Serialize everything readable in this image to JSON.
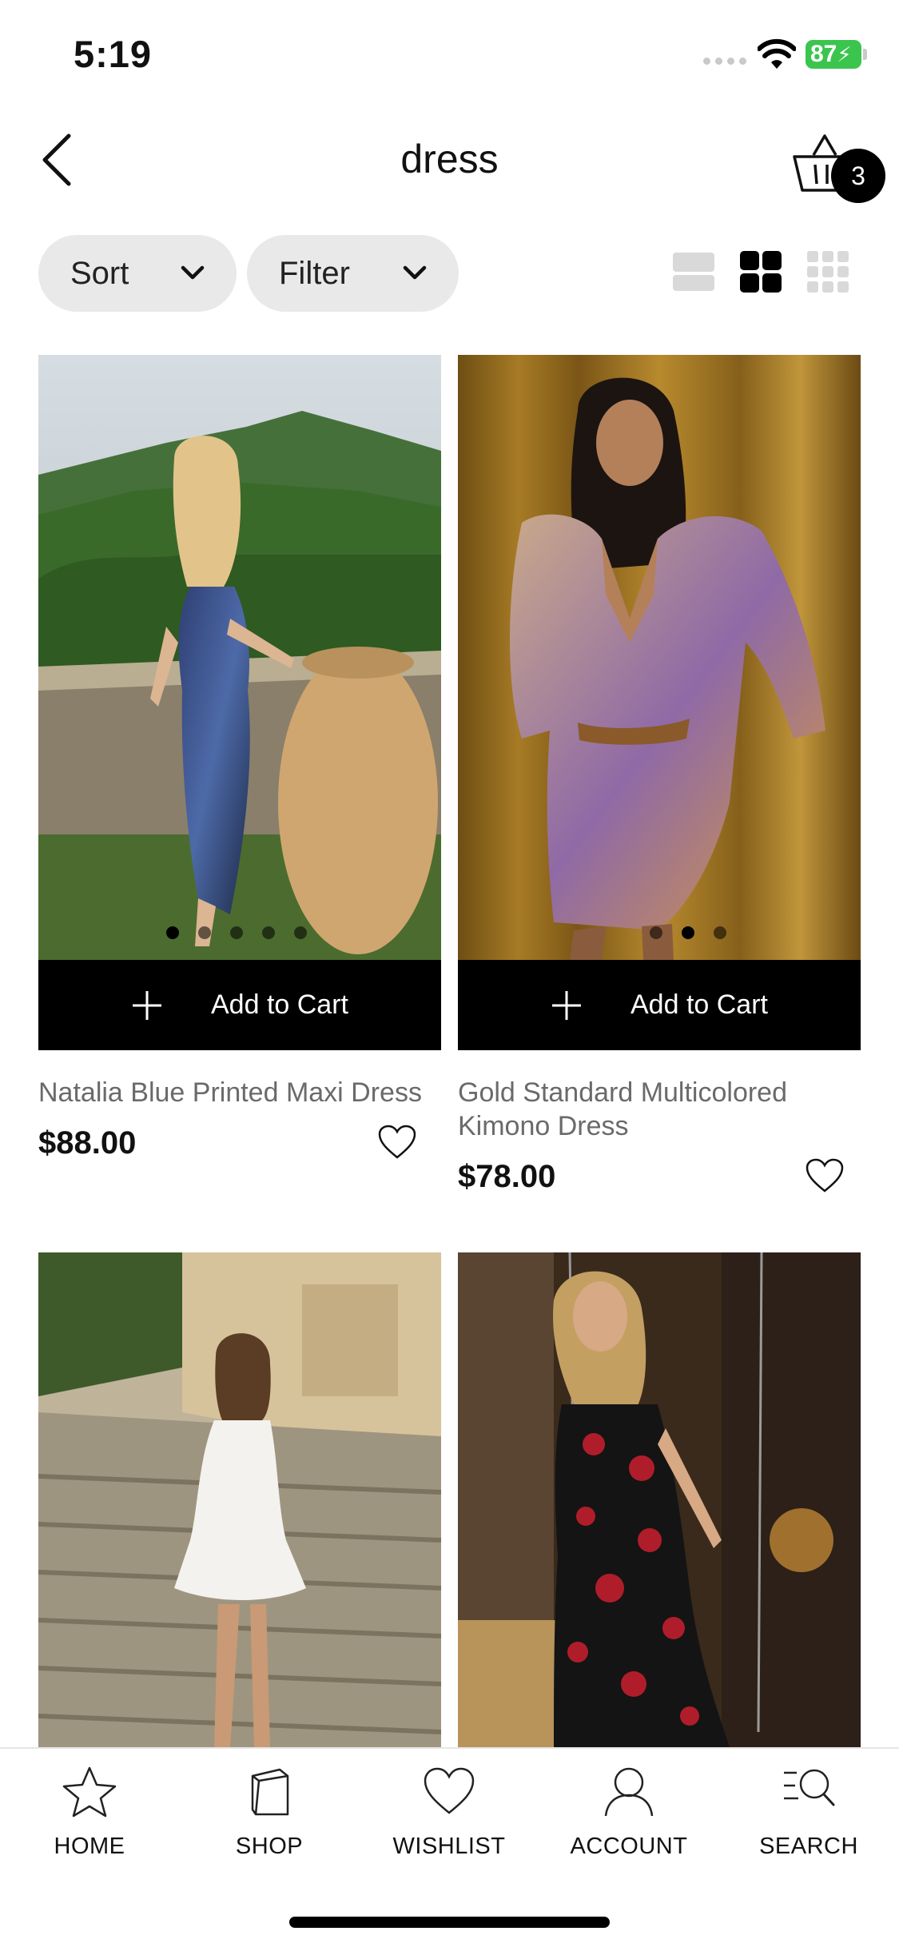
{
  "status_bar": {
    "time": "5:19",
    "battery": "87"
  },
  "header": {
    "title": "dress",
    "cart_count": "3"
  },
  "controls": {
    "sort_label": "Sort",
    "filter_label": "Filter",
    "views": [
      "view-single-icon",
      "view-grid-2-icon",
      "view-grid-3-icon"
    ],
    "active_view": "view-grid-2-icon"
  },
  "products": [
    {
      "name": "Natalia Blue Printed Maxi Dress",
      "price": "$88.00",
      "add_label": "Add to Cart"
    },
    {
      "name": "Gold Standard Multicolored Kimono Dress",
      "price": "$78.00",
      "add_label": "Add to Cart"
    },
    {
      "name": "",
      "price": "",
      "add_label": ""
    },
    {
      "name": "",
      "price": "",
      "add_label": ""
    }
  ],
  "tabs": [
    {
      "label": "HOME",
      "icon": "star-icon"
    },
    {
      "label": "SHOP",
      "icon": "shopping-bag-icon"
    },
    {
      "label": "WISHLIST",
      "icon": "heart-icon"
    },
    {
      "label": "ACCOUNT",
      "icon": "user-icon"
    },
    {
      "label": "SEARCH",
      "icon": "search-list-icon"
    }
  ],
  "colors": {
    "accent": "#000000",
    "battery": "#3bc54e",
    "pill_bg": "#e9e9e9",
    "muted_text": "#6a6a6a"
  }
}
